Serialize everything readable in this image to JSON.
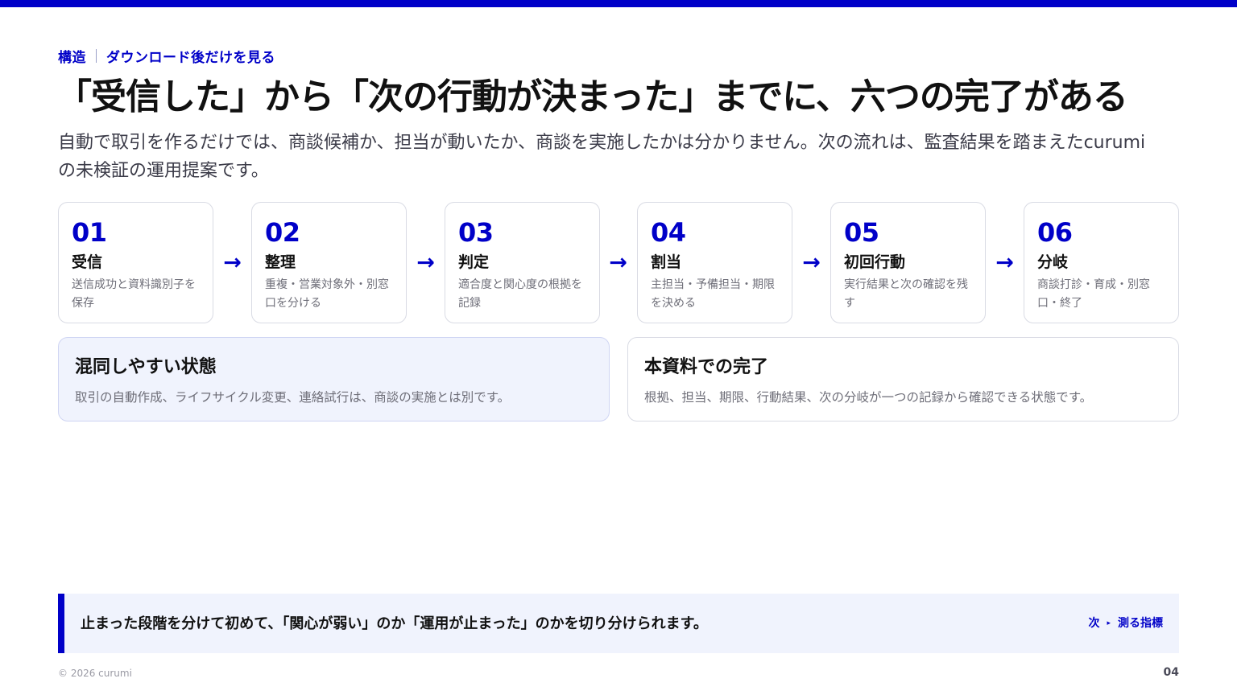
{
  "theme": {
    "accent": "#0000c8",
    "tint": "#f0f3fd",
    "text": "#111111",
    "muted": "#6e6e78"
  },
  "header": {
    "eyebrow_section": "構造",
    "eyebrow_topic": "ダウンロード後だけを見る",
    "title": "「受信した」から「次の行動が決まった」までに、六つの完了がある",
    "lead": "自動で取引を作るだけでは、商談候補か、担当が動いたか、商談を実施したかは分かりません。次の流れは、監査結果を踏まえたcurumiの未検証の運用提案です。"
  },
  "steps": [
    {
      "num": "01",
      "title": "受信",
      "desc": "送信成功と資料識別子を保存"
    },
    {
      "num": "02",
      "title": "整理",
      "desc": "重複・営業対象外・別窓口を分ける"
    },
    {
      "num": "03",
      "title": "判定",
      "desc": "適合度と関心度の根拠を記録"
    },
    {
      "num": "04",
      "title": "割当",
      "desc": "主担当・予備担当・期限を決める"
    },
    {
      "num": "05",
      "title": "初回行動",
      "desc": "実行結果と次の確認を残す"
    },
    {
      "num": "06",
      "title": "分岐",
      "desc": "商談打診・育成・別窓口・終了"
    }
  ],
  "arrow_glyph": "→",
  "cards": {
    "confusing": {
      "title": "混同しやすい状態",
      "text": "取引の自動作成、ライフサイクル変更、連絡試行は、商談の実施とは別です。"
    },
    "complete": {
      "title": "本資料での完了",
      "text": "根拠、担当、期限、行動結果、次の分岐が一つの記録から確認できる状態です。"
    }
  },
  "callout": {
    "text": "止まった段階を分けて初めて、「関心が弱い」のか「運用が止まった」のかを切り分けられます。",
    "next_prefix": "次",
    "next_marker": "▸",
    "next_label": "測る指標"
  },
  "footer": {
    "copyright": "© 2026 curumi",
    "page_number": "04"
  }
}
